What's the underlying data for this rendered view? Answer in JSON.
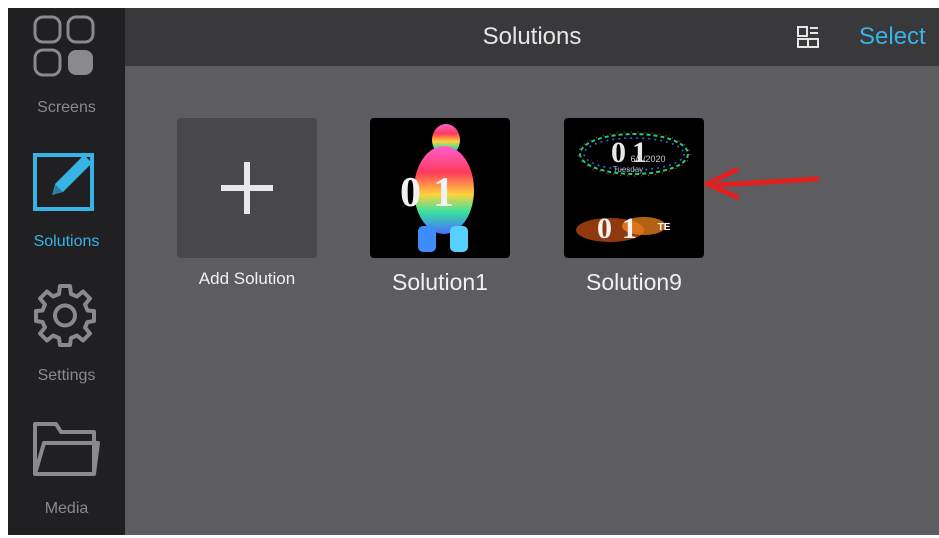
{
  "sidebar": {
    "items": [
      {
        "label": "Screens",
        "icon": "screens-grid-icon",
        "active": false
      },
      {
        "label": "Solutions",
        "icon": "edit-pencil-icon",
        "active": true
      },
      {
        "label": "Settings",
        "icon": "gear-icon",
        "active": false
      },
      {
        "label": "Media",
        "icon": "folder-icon",
        "active": false
      }
    ]
  },
  "header": {
    "title": "Solutions",
    "layout_icon": "layout-toggle-icon",
    "select_label": "Select"
  },
  "solutions": {
    "add_label": "Add Solution",
    "items": [
      {
        "name": "Solution1",
        "thumb_text": "01"
      },
      {
        "name": "Solution9",
        "thumb_text_top": "01",
        "thumb_text_bottom": "01",
        "thumb_date": "6/1/2020",
        "thumb_day": "Tuesday",
        "thumb_tag": "TE"
      }
    ]
  },
  "colors": {
    "accent": "#38b3e6",
    "sidebar_bg": "#202022",
    "topbar_bg": "#39393c",
    "content_bg": "#5d5d61",
    "annotation_arrow": "#e32020"
  }
}
